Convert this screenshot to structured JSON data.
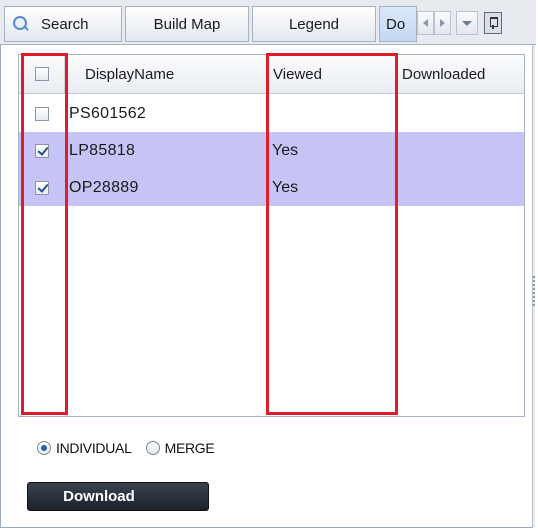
{
  "tabs": [
    {
      "label": "Search",
      "icon": "search-icon"
    },
    {
      "label": "Build Map"
    },
    {
      "label": "Legend"
    },
    {
      "label": "Do"
    }
  ],
  "grid": {
    "columns": [
      "DisplayName",
      "Viewed",
      "Downloaded"
    ],
    "rows": [
      {
        "checked": false,
        "name": "PS601562",
        "viewed": "",
        "downloaded": "",
        "selected": false
      },
      {
        "checked": true,
        "name": "LP85818",
        "viewed": "Yes",
        "downloaded": "",
        "selected": true
      },
      {
        "checked": true,
        "name": "OP28889",
        "viewed": "Yes",
        "downloaded": "",
        "selected": true
      }
    ]
  },
  "options": {
    "individual_label": "INDIVIDUAL",
    "merge_label": "MERGE",
    "selected": "INDIVIDUAL"
  },
  "download_label": "Download",
  "colors": {
    "highlight": "#e01b2a",
    "row_selected": "#c6c4f6",
    "button_dark": "#1c222c"
  }
}
